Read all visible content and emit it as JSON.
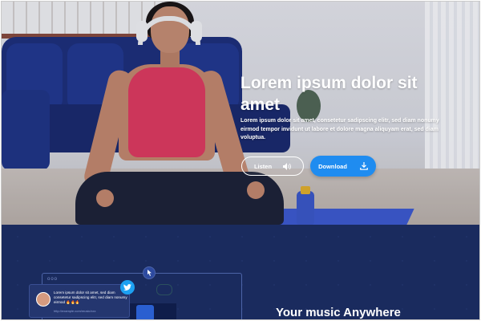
{
  "hero": {
    "title": "Lorem ipsum dolor sit amet",
    "body": "Lorem ipsum dolor sit amet, consetetur sadipscing elitr, sed diam nonumy eirmod tempor invidunt ut labore et dolore magna aliquyam erat, sed diam voluptua.",
    "listen_label": "Listen",
    "download_label": "Download",
    "colors": {
      "download": "#1f8cf0",
      "text": "#ffffff"
    }
  },
  "lower": {
    "heading": "Your music Anywhere",
    "tweet": {
      "text": "Lorem ipsum dolor sit amet, sed diam consetetur sadipscing elitr, sed diam nonumy eirmod",
      "emoji": "🔥🔥🔥",
      "link": "http://example.com/music/xxx"
    },
    "screen_bar": "ooo",
    "colors": {
      "background": "#1a2b5e",
      "twitter": "#1da1f2"
    }
  },
  "icons": {
    "listen": "speaker-icon",
    "download": "download-icon",
    "twitter": "twitter-icon",
    "badge": "cursor-icon"
  }
}
